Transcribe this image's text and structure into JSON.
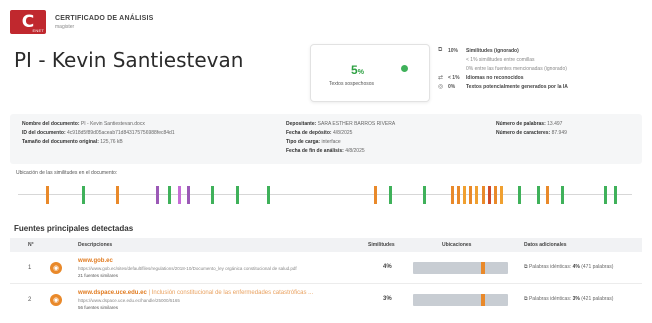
{
  "header": {
    "logo_letter": "C",
    "logo_small": "ENET",
    "title": "CERTIFICADO DE ANÁLISIS",
    "subtitle": "magister"
  },
  "page_title": "PI - Kevin Santiestevan",
  "similarity": {
    "percent": "5",
    "percent_unit": "%",
    "label": "Textos sospechosos",
    "accent_color": "#2ea143"
  },
  "similarity_details": [
    {
      "icon": "copy-icon",
      "glyph": "⧉",
      "num": "10%",
      "text": "Similitudes (ignorado)",
      "indent": false
    },
    {
      "icon": "",
      "glyph": "",
      "num": "",
      "text": "< 1%  similitudes entre comillas",
      "indent": true
    },
    {
      "icon": "",
      "glyph": "",
      "num": "",
      "text": "0%  entre las fuentes mencionadas (ignorado)",
      "indent": true
    },
    {
      "icon": "translate-icon",
      "glyph": "⇄",
      "num": "< 1%",
      "text": "Idiomas no reconocidos",
      "indent": false
    },
    {
      "icon": "ai-icon",
      "glyph": "◎",
      "num": "0%",
      "text": "Textos potencialmente generados por la IA",
      "indent": false
    }
  ],
  "metadata": {
    "col1": [
      {
        "label": "Nombre del documento:",
        "value": "PI - Kevin Santiestevan.docx"
      },
      {
        "label": "ID del documento:",
        "value": "4c918d5f89d05aceab71d843175756988fec84d1"
      },
      {
        "label": "Tamaño del documento original:",
        "value": "125,76 kB"
      }
    ],
    "col2": [
      {
        "label": "Depositante:",
        "value": "SARA ESTHER BARROS RIVERA"
      },
      {
        "label": "Fecha de depósito:",
        "value": "4/8/2025"
      },
      {
        "label": "Tipo de carga:",
        "value": "interface"
      },
      {
        "label": "Fecha de fin de análisis:",
        "value": "4/8/2025"
      }
    ],
    "col3": [
      {
        "label": "Número de palabras:",
        "value": "13.497"
      },
      {
        "label": "Número de caracteres:",
        "value": "87.949"
      }
    ]
  },
  "location": {
    "label": "Ubicación de las similitudes en el documento:",
    "marks": [
      {
        "pos": 0.045,
        "color": "#e9892a"
      },
      {
        "pos": 0.105,
        "color": "#3fb15a"
      },
      {
        "pos": 0.16,
        "color": "#e9892a"
      },
      {
        "pos": 0.225,
        "color": "#9b59b6"
      },
      {
        "pos": 0.245,
        "color": "#3fb15a"
      },
      {
        "pos": 0.26,
        "color": "#c56cd6"
      },
      {
        "pos": 0.275,
        "color": "#9b59b6"
      },
      {
        "pos": 0.315,
        "color": "#3fb15a"
      },
      {
        "pos": 0.355,
        "color": "#3fb15a"
      },
      {
        "pos": 0.405,
        "color": "#3fb15a"
      },
      {
        "pos": 0.58,
        "color": "#e9892a"
      },
      {
        "pos": 0.605,
        "color": "#3fb15a"
      },
      {
        "pos": 0.66,
        "color": "#3fb15a"
      },
      {
        "pos": 0.705,
        "color": "#e9892a"
      },
      {
        "pos": 0.715,
        "color": "#e9892a"
      },
      {
        "pos": 0.725,
        "color": "#f0a030"
      },
      {
        "pos": 0.735,
        "color": "#e9892a"
      },
      {
        "pos": 0.745,
        "color": "#f0a030"
      },
      {
        "pos": 0.755,
        "color": "#e9892a"
      },
      {
        "pos": 0.765,
        "color": "#d04a2a"
      },
      {
        "pos": 0.775,
        "color": "#e9892a"
      },
      {
        "pos": 0.785,
        "color": "#f0a030"
      },
      {
        "pos": 0.815,
        "color": "#3fb15a"
      },
      {
        "pos": 0.845,
        "color": "#3fb15a"
      },
      {
        "pos": 0.86,
        "color": "#e9892a"
      },
      {
        "pos": 0.885,
        "color": "#3fb15a"
      },
      {
        "pos": 0.955,
        "color": "#3fb15a"
      },
      {
        "pos": 0.97,
        "color": "#3fb15a"
      }
    ]
  },
  "sources": {
    "title": "Fuentes principales detectadas",
    "headers": {
      "n": "N°",
      "desc": "Descripciones",
      "sim": "Similitudes",
      "loc": "Ubicaciones",
      "extra": "Datos adicionales"
    },
    "rows": [
      {
        "n": "1",
        "title": "www.gob.ec",
        "extra_title": "",
        "url": "https://www.gob.ec/sites/default/files/regulations/2018-10/Documento_ley orgánica constitucional de salud.pdf",
        "count": "21 fuentes similares",
        "pct": "4%",
        "loc_fraction": 0.72,
        "extra_label": "Palabras idénticas:",
        "extra_value": "4%",
        "extra_words": "(471 palabras)"
      },
      {
        "n": "2",
        "title": "www.dspace.uce.edu.ec",
        "extra_title": "| Inclusión constitucional de las enfermedades catastróficas ...",
        "url": "https://www.dspace.uce.edu.ec/handle/25000/5165",
        "count": "56 fuentes similares",
        "pct": "3%",
        "loc_fraction": 0.72,
        "extra_label": "Palabras idénticas:",
        "extra_value": "3%",
        "extra_words": "(421 palabras)"
      }
    ]
  }
}
